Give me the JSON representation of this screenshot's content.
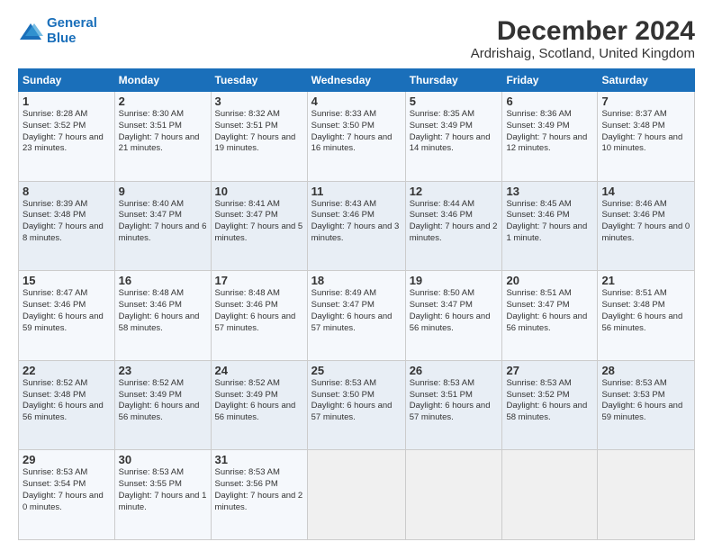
{
  "logo": {
    "line1": "General",
    "line2": "Blue"
  },
  "title": "December 2024",
  "subtitle": "Ardrishaig, Scotland, United Kingdom",
  "days_header": [
    "Sunday",
    "Monday",
    "Tuesday",
    "Wednesday",
    "Thursday",
    "Friday",
    "Saturday"
  ],
  "weeks": [
    [
      {
        "day": "1",
        "sunrise": "Sunrise: 8:28 AM",
        "sunset": "Sunset: 3:52 PM",
        "daylight": "Daylight: 7 hours and 23 minutes."
      },
      {
        "day": "2",
        "sunrise": "Sunrise: 8:30 AM",
        "sunset": "Sunset: 3:51 PM",
        "daylight": "Daylight: 7 hours and 21 minutes."
      },
      {
        "day": "3",
        "sunrise": "Sunrise: 8:32 AM",
        "sunset": "Sunset: 3:51 PM",
        "daylight": "Daylight: 7 hours and 19 minutes."
      },
      {
        "day": "4",
        "sunrise": "Sunrise: 8:33 AM",
        "sunset": "Sunset: 3:50 PM",
        "daylight": "Daylight: 7 hours and 16 minutes."
      },
      {
        "day": "5",
        "sunrise": "Sunrise: 8:35 AM",
        "sunset": "Sunset: 3:49 PM",
        "daylight": "Daylight: 7 hours and 14 minutes."
      },
      {
        "day": "6",
        "sunrise": "Sunrise: 8:36 AM",
        "sunset": "Sunset: 3:49 PM",
        "daylight": "Daylight: 7 hours and 12 minutes."
      },
      {
        "day": "7",
        "sunrise": "Sunrise: 8:37 AM",
        "sunset": "Sunset: 3:48 PM",
        "daylight": "Daylight: 7 hours and 10 minutes."
      }
    ],
    [
      {
        "day": "8",
        "sunrise": "Sunrise: 8:39 AM",
        "sunset": "Sunset: 3:48 PM",
        "daylight": "Daylight: 7 hours and 8 minutes."
      },
      {
        "day": "9",
        "sunrise": "Sunrise: 8:40 AM",
        "sunset": "Sunset: 3:47 PM",
        "daylight": "Daylight: 7 hours and 6 minutes."
      },
      {
        "day": "10",
        "sunrise": "Sunrise: 8:41 AM",
        "sunset": "Sunset: 3:47 PM",
        "daylight": "Daylight: 7 hours and 5 minutes."
      },
      {
        "day": "11",
        "sunrise": "Sunrise: 8:43 AM",
        "sunset": "Sunset: 3:46 PM",
        "daylight": "Daylight: 7 hours and 3 minutes."
      },
      {
        "day": "12",
        "sunrise": "Sunrise: 8:44 AM",
        "sunset": "Sunset: 3:46 PM",
        "daylight": "Daylight: 7 hours and 2 minutes."
      },
      {
        "day": "13",
        "sunrise": "Sunrise: 8:45 AM",
        "sunset": "Sunset: 3:46 PM",
        "daylight": "Daylight: 7 hours and 1 minute."
      },
      {
        "day": "14",
        "sunrise": "Sunrise: 8:46 AM",
        "sunset": "Sunset: 3:46 PM",
        "daylight": "Daylight: 7 hours and 0 minutes."
      }
    ],
    [
      {
        "day": "15",
        "sunrise": "Sunrise: 8:47 AM",
        "sunset": "Sunset: 3:46 PM",
        "daylight": "Daylight: 6 hours and 59 minutes."
      },
      {
        "day": "16",
        "sunrise": "Sunrise: 8:48 AM",
        "sunset": "Sunset: 3:46 PM",
        "daylight": "Daylight: 6 hours and 58 minutes."
      },
      {
        "day": "17",
        "sunrise": "Sunrise: 8:48 AM",
        "sunset": "Sunset: 3:46 PM",
        "daylight": "Daylight: 6 hours and 57 minutes."
      },
      {
        "day": "18",
        "sunrise": "Sunrise: 8:49 AM",
        "sunset": "Sunset: 3:47 PM",
        "daylight": "Daylight: 6 hours and 57 minutes."
      },
      {
        "day": "19",
        "sunrise": "Sunrise: 8:50 AM",
        "sunset": "Sunset: 3:47 PM",
        "daylight": "Daylight: 6 hours and 56 minutes."
      },
      {
        "day": "20",
        "sunrise": "Sunrise: 8:51 AM",
        "sunset": "Sunset: 3:47 PM",
        "daylight": "Daylight: 6 hours and 56 minutes."
      },
      {
        "day": "21",
        "sunrise": "Sunrise: 8:51 AM",
        "sunset": "Sunset: 3:48 PM",
        "daylight": "Daylight: 6 hours and 56 minutes."
      }
    ],
    [
      {
        "day": "22",
        "sunrise": "Sunrise: 8:52 AM",
        "sunset": "Sunset: 3:48 PM",
        "daylight": "Daylight: 6 hours and 56 minutes."
      },
      {
        "day": "23",
        "sunrise": "Sunrise: 8:52 AM",
        "sunset": "Sunset: 3:49 PM",
        "daylight": "Daylight: 6 hours and 56 minutes."
      },
      {
        "day": "24",
        "sunrise": "Sunrise: 8:52 AM",
        "sunset": "Sunset: 3:49 PM",
        "daylight": "Daylight: 6 hours and 56 minutes."
      },
      {
        "day": "25",
        "sunrise": "Sunrise: 8:53 AM",
        "sunset": "Sunset: 3:50 PM",
        "daylight": "Daylight: 6 hours and 57 minutes."
      },
      {
        "day": "26",
        "sunrise": "Sunrise: 8:53 AM",
        "sunset": "Sunset: 3:51 PM",
        "daylight": "Daylight: 6 hours and 57 minutes."
      },
      {
        "day": "27",
        "sunrise": "Sunrise: 8:53 AM",
        "sunset": "Sunset: 3:52 PM",
        "daylight": "Daylight: 6 hours and 58 minutes."
      },
      {
        "day": "28",
        "sunrise": "Sunrise: 8:53 AM",
        "sunset": "Sunset: 3:53 PM",
        "daylight": "Daylight: 6 hours and 59 minutes."
      }
    ],
    [
      {
        "day": "29",
        "sunrise": "Sunrise: 8:53 AM",
        "sunset": "Sunset: 3:54 PM",
        "daylight": "Daylight: 7 hours and 0 minutes."
      },
      {
        "day": "30",
        "sunrise": "Sunrise: 8:53 AM",
        "sunset": "Sunset: 3:55 PM",
        "daylight": "Daylight: 7 hours and 1 minute."
      },
      {
        "day": "31",
        "sunrise": "Sunrise: 8:53 AM",
        "sunset": "Sunset: 3:56 PM",
        "daylight": "Daylight: 7 hours and 2 minutes."
      },
      null,
      null,
      null,
      null
    ]
  ]
}
